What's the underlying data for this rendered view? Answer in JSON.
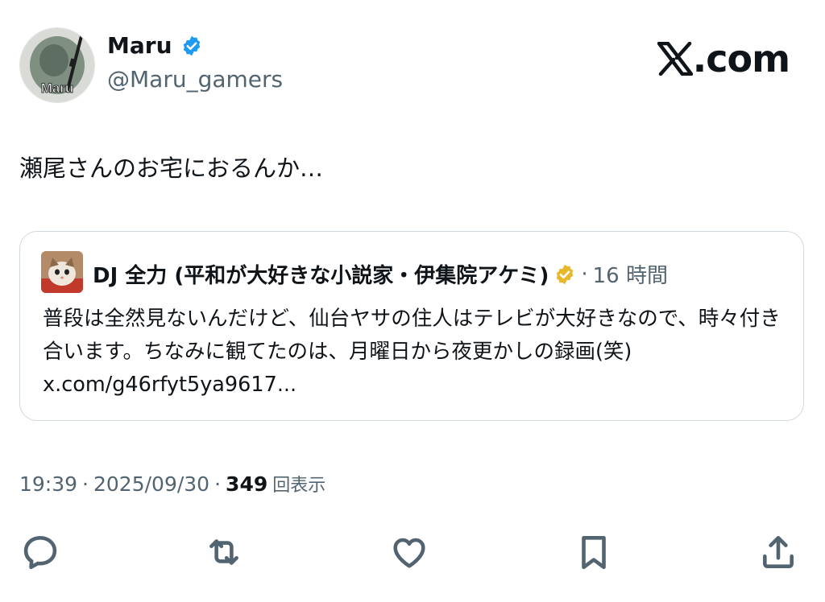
{
  "author": {
    "display_name": "Maru",
    "handle": "@Maru_gamers",
    "avatar_text": "Maru",
    "verified_color": "#1d9bf0"
  },
  "brand": {
    "text": ".com"
  },
  "tweet": {
    "text": "瀬尾さんのお宅におるんか…"
  },
  "quote": {
    "author_name": "DJ 全力 (平和が大好きな小説家・伊集院アケミ)",
    "verified_color": "#e8b82c",
    "separator": "·",
    "time": "16 時間",
    "body": "普段は全然見ないんだけど、仙台ヤサの住人はテレビが大好きなので、時々付き合います。ちなみに観てたのは、月曜日から夜更かしの録画(笑) ",
    "link": "x.com/g46rfyt5ya9617..."
  },
  "meta": {
    "time": "19:39",
    "sep1": "·",
    "date": "2025/09/30",
    "sep2": "·",
    "views_count": "349",
    "views_label": "回表示"
  },
  "actions": {
    "reply": "reply-icon",
    "repost": "repost-icon",
    "like": "heart-icon",
    "bookmark": "bookmark-icon",
    "share": "share-icon"
  }
}
